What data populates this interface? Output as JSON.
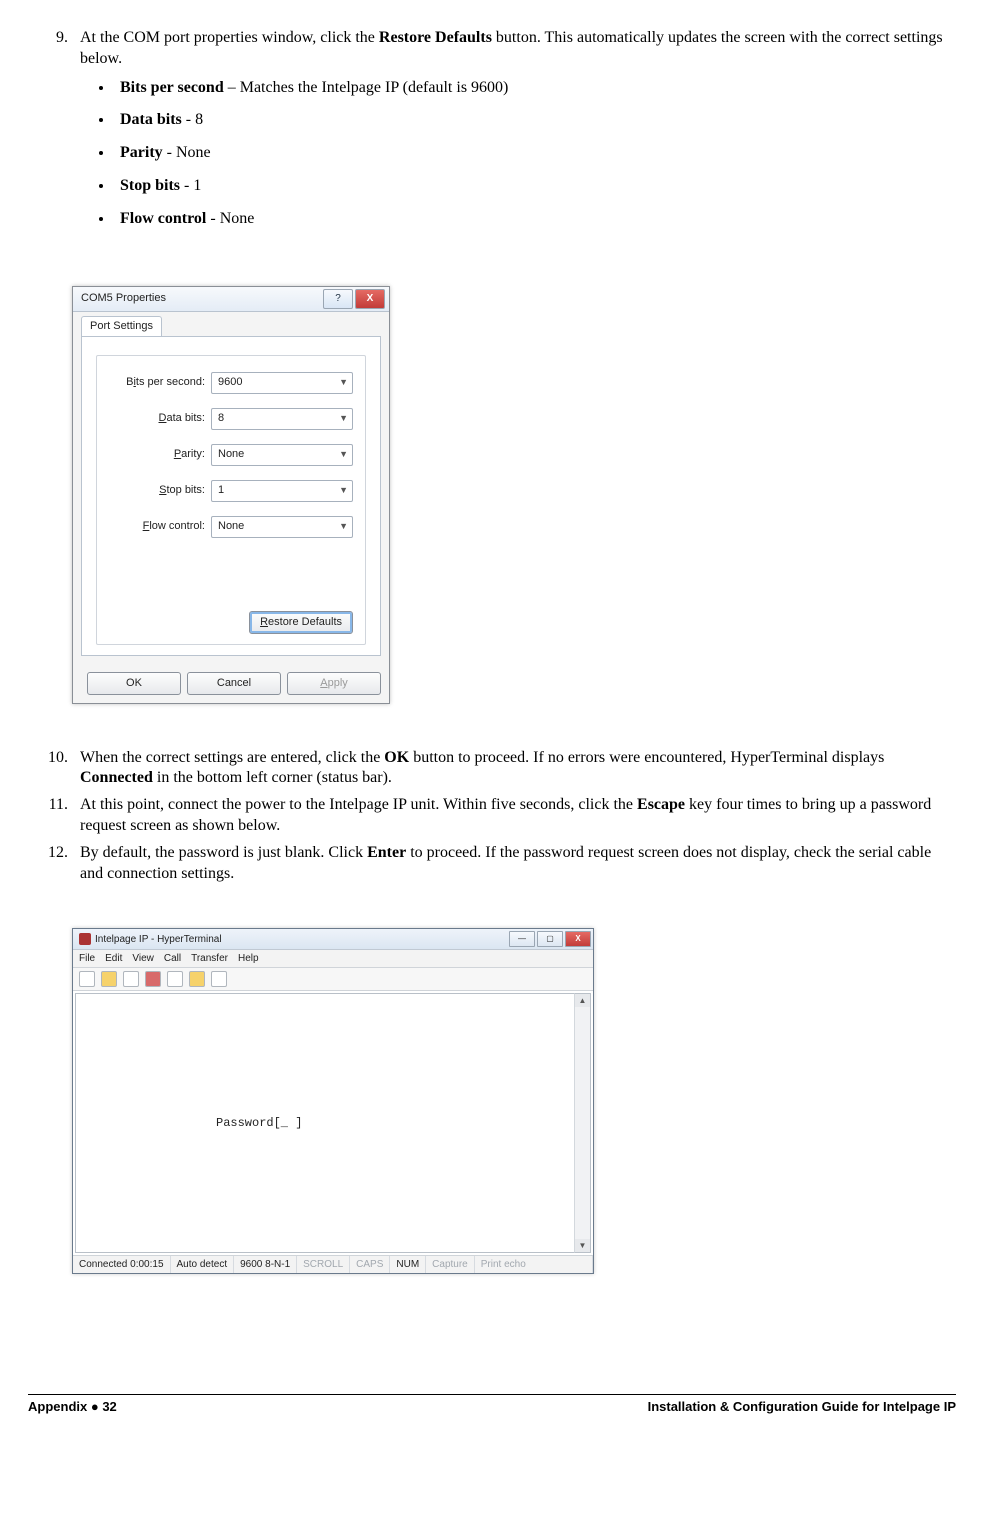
{
  "step9": {
    "num": "9.",
    "text_a": "At the COM port properties window, click the ",
    "bold_a": "Restore Defaults",
    "text_b": " button. This automatically updates the screen with the correct settings below."
  },
  "settings": {
    "bps": {
      "label": "Bits per second",
      "rest": " – Matches the Intelpage IP (default is 9600)"
    },
    "databits": {
      "label": "Data bits",
      "rest": " - 8"
    },
    "parity": {
      "label": "Parity",
      "rest": " - None"
    },
    "stopbits": {
      "label": "Stop bits",
      "rest": " - 1"
    },
    "flow": {
      "label": "Flow control",
      "rest": " - None"
    }
  },
  "dialog": {
    "title": "COM5 Properties",
    "help": "?",
    "close": "X",
    "tab": "Port Settings",
    "rows": {
      "bps": {
        "label_pre": "B",
        "label_u": "i",
        "label_post": "ts per second:",
        "value": "9600"
      },
      "databits": {
        "label_pre": "",
        "label_u": "D",
        "label_post": "ata bits:",
        "value": "8"
      },
      "parity": {
        "label_pre": "",
        "label_u": "P",
        "label_post": "arity:",
        "value": "None"
      },
      "stopbits": {
        "label_pre": "",
        "label_u": "S",
        "label_post": "top bits:",
        "value": "1"
      },
      "flow": {
        "label_pre": "",
        "label_u": "F",
        "label_post": "low control:",
        "value": "None"
      }
    },
    "restore_pre": "R",
    "restore_rest": "estore Defaults",
    "ok": "OK",
    "cancel": "Cancel",
    "apply_pre": "A",
    "apply_rest": "pply"
  },
  "step10": {
    "num": "10.",
    "a": "When the correct settings are entered, click the ",
    "b1": "OK",
    "c": " button to proceed. If no errors were encountered, HyperTerminal displays ",
    "b2": "Connected",
    "d": " in the bottom left corner (status bar)."
  },
  "step11": {
    "num": "11.",
    "a": "At this point, connect the power to the Intelpage IP unit. Within five seconds, click the ",
    "b1": "Escape",
    "c": " key four times to bring up a password request screen as shown below."
  },
  "step12": {
    "num": "12.",
    "a": "By default, the password is just blank. Click ",
    "b1": "Enter",
    "c": " to proceed. If the password request screen does not display, check the serial cable and connection settings."
  },
  "ht": {
    "title": "Intelpage IP - HyperTerminal",
    "menu": {
      "file": "File",
      "edit": "Edit",
      "view": "View",
      "call": "Call",
      "transfer": "Transfer",
      "help": "Help"
    },
    "win": {
      "min": "—",
      "max": "▢",
      "close": "X"
    },
    "terminal_text": "Password[_        ]",
    "status": {
      "connected": "Connected 0:00:15",
      "auto": "Auto detect",
      "mode": "9600 8-N-1",
      "scroll": "SCROLL",
      "caps": "CAPS",
      "num": "NUM",
      "capture": "Capture",
      "echo": "Print echo"
    }
  },
  "footer": {
    "left_a": "Appendix  ",
    "left_dot": "●",
    "left_b": "  32",
    "right": "Installation & Configuration Guide for Intelpage IP"
  }
}
